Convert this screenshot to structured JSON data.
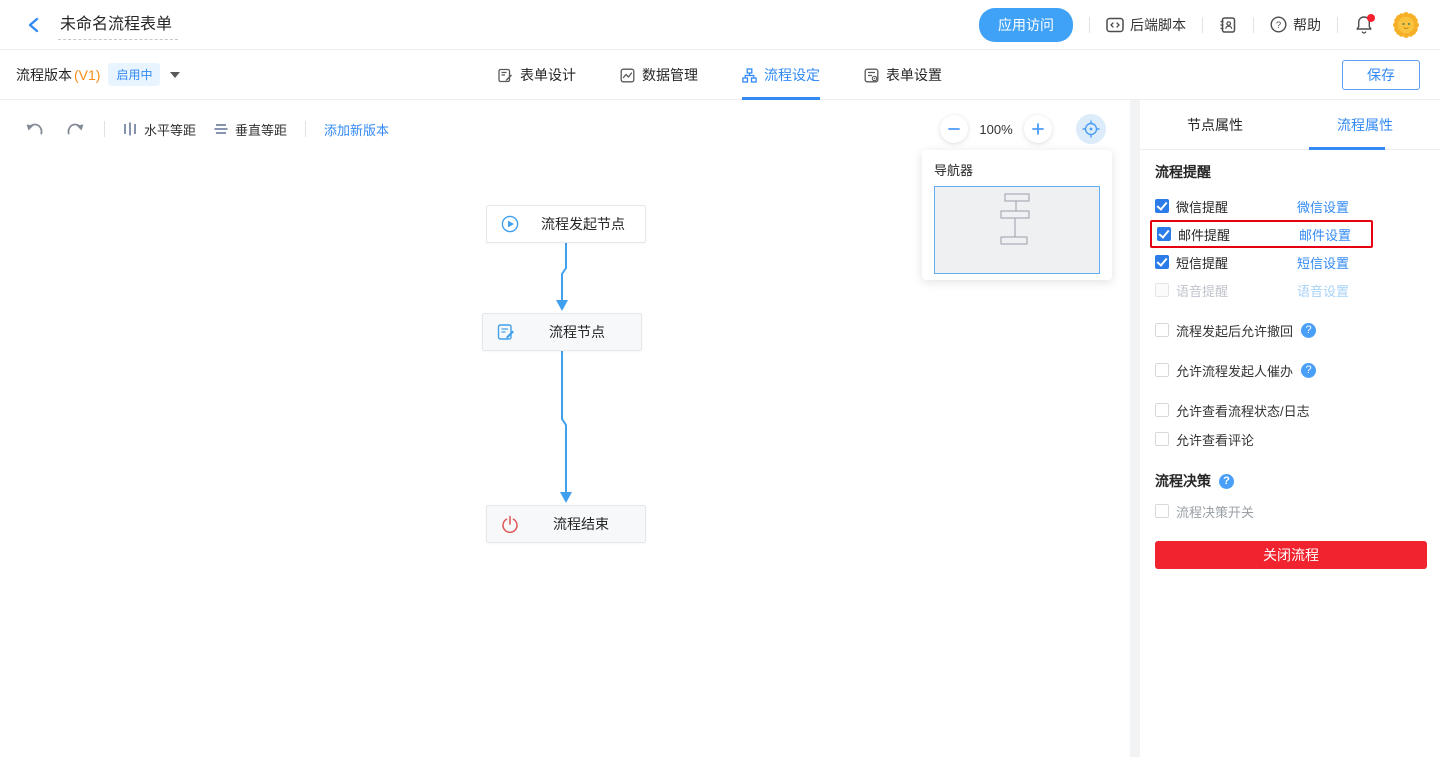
{
  "header": {
    "title": "未命名流程表单",
    "app_access_button": "应用访问",
    "backend_script_label": "后端脚本",
    "help_label": "帮助",
    "icons": [
      "back-icon",
      "code-icon",
      "contacts-icon",
      "help-icon",
      "bell-icon",
      "avatar-sun"
    ]
  },
  "version_bar": {
    "version_label": "流程版本",
    "version_number": "(V1)",
    "status_badge": "启用中",
    "save_button": "保存",
    "tabs": [
      {
        "label": "表单设计",
        "active": false,
        "icon": "form-design-icon"
      },
      {
        "label": "数据管理",
        "active": false,
        "icon": "data-manage-icon"
      },
      {
        "label": "流程设定",
        "active": true,
        "icon": "flow-setting-icon"
      },
      {
        "label": "表单设置",
        "active": false,
        "icon": "form-settings-icon"
      }
    ]
  },
  "canvas": {
    "toolbar": {
      "undo_icon": "undo-icon",
      "redo_icon": "redo-icon",
      "horizontal_spacing": "水平等距",
      "vertical_spacing": "垂直等距",
      "add_version_link": "添加新版本",
      "zoom_level": "100%"
    },
    "navigator": {
      "title": "导航器"
    },
    "nodes": [
      {
        "label": "流程发起节点",
        "icon": "play-icon"
      },
      {
        "label": "流程节点",
        "icon": "form-edit-icon"
      },
      {
        "label": "流程结束",
        "icon": "power-icon"
      }
    ]
  },
  "sidebar": {
    "tabs": [
      {
        "label": "节点属性",
        "active": false
      },
      {
        "label": "流程属性",
        "active": true
      }
    ],
    "reminder_section": {
      "heading": "流程提醒",
      "rows": [
        {
          "label": "微信提醒",
          "link": "微信设置",
          "checked": true,
          "disabled": false,
          "highlighted": false
        },
        {
          "label": "邮件提醒",
          "link": "邮件设置",
          "checked": true,
          "disabled": false,
          "highlighted": true
        },
        {
          "label": "短信提醒",
          "link": "短信设置",
          "checked": true,
          "disabled": false,
          "highlighted": false
        },
        {
          "label": "语音提醒",
          "link": "语音设置",
          "checked": false,
          "disabled": true,
          "highlighted": false
        }
      ]
    },
    "options": [
      {
        "label": "流程发起后允许撤回",
        "help": true,
        "checked": false
      },
      {
        "label": "允许流程发起人催办",
        "help": true,
        "checked": false
      },
      {
        "label": "允许查看流程状态/日志",
        "help": false,
        "checked": false
      },
      {
        "label": "允许查看评论",
        "help": false,
        "checked": false
      }
    ],
    "decision_section": {
      "heading": "流程决策",
      "switch_label": "流程决策开关",
      "switch_checked": false
    },
    "close_button": "关闭流程",
    "help_glyph": "?"
  },
  "colors": {
    "accent_blue": "#338af5",
    "pill_blue": "#3fa2f7",
    "connector_blue": "#41a0ee",
    "highlight_red": "#e60012",
    "danger_red": "#f1232e",
    "version_orange": "#fa8c16",
    "badge_bg": "#e8f4ff",
    "node_gray_bg": "#f7f8fa"
  }
}
